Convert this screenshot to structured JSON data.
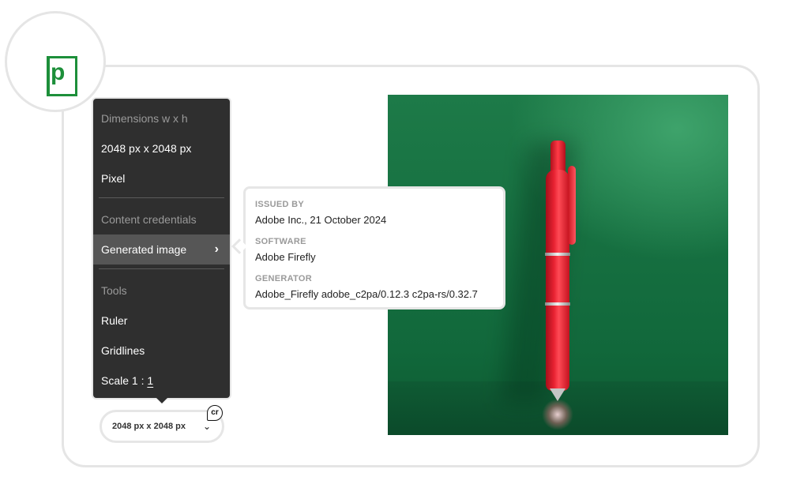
{
  "logo": {
    "letter": "p",
    "color": "#1d8f3a"
  },
  "menu": {
    "items": [
      {
        "label": "Dimensions w x h",
        "kind": "header"
      },
      {
        "label": "2048 px x 2048 px",
        "kind": "option"
      },
      {
        "label": "Pixel",
        "kind": "option"
      },
      {
        "label": "Content credentials",
        "kind": "header"
      },
      {
        "label": "Generated image",
        "kind": "option",
        "active": true,
        "has_submenu": true
      },
      {
        "label": "Tools",
        "kind": "header"
      },
      {
        "label": "Ruler",
        "kind": "option"
      },
      {
        "label": "Gridlines",
        "kind": "option"
      },
      {
        "label": "Scale 1 : ",
        "kind": "option"
      }
    ],
    "scale_value": "1",
    "chevron_glyph": "›"
  },
  "credentials": {
    "issued_by_label": "ISSUED BY",
    "issued_by_value": "Adobe Inc., 21 October 2024",
    "software_label": "SOFTWARE",
    "software_value": "Adobe Firefly",
    "generator_label": "GENERATOR",
    "generator_value": "Adobe_Firefly adobe_c2pa/0.12.3 c2pa-rs/0.32.7"
  },
  "dimension_select": {
    "value": "2048 px x 2048 px",
    "caret_glyph": "⌄"
  },
  "cr_badge": {
    "text": "cr"
  },
  "colors": {
    "menu_bg": "#2f2f2f",
    "menu_active": "#565656",
    "accent_green": "#1d8f3a"
  }
}
